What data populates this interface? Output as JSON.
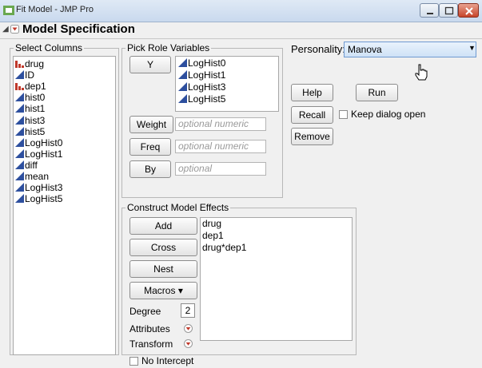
{
  "window": {
    "title": "Fit Model - JMP Pro"
  },
  "header": {
    "title": "Model Specification"
  },
  "select_columns": {
    "title": "Select Columns",
    "items": [
      {
        "label": "drug",
        "type": "nominal"
      },
      {
        "label": "ID",
        "type": "continuous"
      },
      {
        "label": "dep1",
        "type": "nominal"
      },
      {
        "label": "hist0",
        "type": "continuous"
      },
      {
        "label": "hist1",
        "type": "continuous"
      },
      {
        "label": "hist3",
        "type": "continuous"
      },
      {
        "label": "hist5",
        "type": "continuous"
      },
      {
        "label": "LogHist0",
        "type": "continuous"
      },
      {
        "label": "LogHist1",
        "type": "continuous"
      },
      {
        "label": "diff",
        "type": "continuous"
      },
      {
        "label": "mean",
        "type": "continuous"
      },
      {
        "label": "LogHist3",
        "type": "continuous"
      },
      {
        "label": "LogHist5",
        "type": "continuous"
      }
    ]
  },
  "pick_role": {
    "title": "Pick Role Variables",
    "y_label": "Y",
    "y_items": [
      "LogHist0",
      "LogHist1",
      "LogHist3",
      "LogHist5"
    ],
    "weight_label": "Weight",
    "weight_placeholder": "optional numeric",
    "freq_label": "Freq",
    "freq_placeholder": "optional numeric",
    "by_label": "By",
    "by_placeholder": "optional"
  },
  "personality": {
    "label": "Personality:",
    "value": "Manova"
  },
  "actions": {
    "help": "Help",
    "run": "Run",
    "recall": "Recall",
    "keep_open": "Keep dialog open",
    "remove": "Remove"
  },
  "construct": {
    "title": "Construct Model Effects",
    "add": "Add",
    "cross": "Cross",
    "nest": "Nest",
    "macros": "Macros ▾",
    "degree_label": "Degree",
    "degree_value": "2",
    "attributes": "Attributes",
    "transform": "Transform",
    "no_intercept": "No Intercept",
    "effects": [
      "drug",
      "dep1",
      "drug*dep1"
    ]
  },
  "colors": {
    "nominal": "#c0392b",
    "continuous": "#2d4f9e",
    "accent": "#2d6fd6"
  }
}
